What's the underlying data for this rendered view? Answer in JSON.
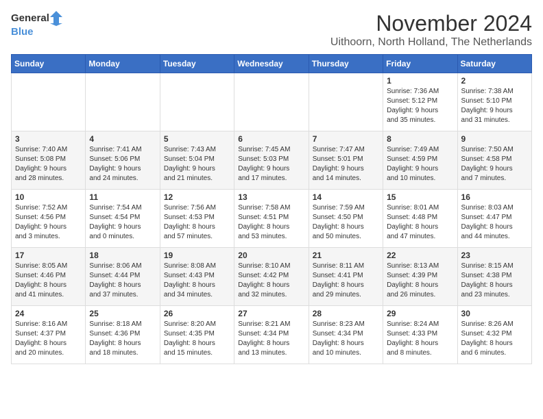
{
  "header": {
    "logo_general": "General",
    "logo_blue": "Blue",
    "month_title": "November 2024",
    "location": "Uithoorn, North Holland, The Netherlands"
  },
  "weekdays": [
    "Sunday",
    "Monday",
    "Tuesday",
    "Wednesday",
    "Thursday",
    "Friday",
    "Saturday"
  ],
  "weeks": [
    [
      {
        "day": "",
        "info": ""
      },
      {
        "day": "",
        "info": ""
      },
      {
        "day": "",
        "info": ""
      },
      {
        "day": "",
        "info": ""
      },
      {
        "day": "",
        "info": ""
      },
      {
        "day": "1",
        "info": "Sunrise: 7:36 AM\nSunset: 5:12 PM\nDaylight: 9 hours\nand 35 minutes."
      },
      {
        "day": "2",
        "info": "Sunrise: 7:38 AM\nSunset: 5:10 PM\nDaylight: 9 hours\nand 31 minutes."
      }
    ],
    [
      {
        "day": "3",
        "info": "Sunrise: 7:40 AM\nSunset: 5:08 PM\nDaylight: 9 hours\nand 28 minutes."
      },
      {
        "day": "4",
        "info": "Sunrise: 7:41 AM\nSunset: 5:06 PM\nDaylight: 9 hours\nand 24 minutes."
      },
      {
        "day": "5",
        "info": "Sunrise: 7:43 AM\nSunset: 5:04 PM\nDaylight: 9 hours\nand 21 minutes."
      },
      {
        "day": "6",
        "info": "Sunrise: 7:45 AM\nSunset: 5:03 PM\nDaylight: 9 hours\nand 17 minutes."
      },
      {
        "day": "7",
        "info": "Sunrise: 7:47 AM\nSunset: 5:01 PM\nDaylight: 9 hours\nand 14 minutes."
      },
      {
        "day": "8",
        "info": "Sunrise: 7:49 AM\nSunset: 4:59 PM\nDaylight: 9 hours\nand 10 minutes."
      },
      {
        "day": "9",
        "info": "Sunrise: 7:50 AM\nSunset: 4:58 PM\nDaylight: 9 hours\nand 7 minutes."
      }
    ],
    [
      {
        "day": "10",
        "info": "Sunrise: 7:52 AM\nSunset: 4:56 PM\nDaylight: 9 hours\nand 3 minutes."
      },
      {
        "day": "11",
        "info": "Sunrise: 7:54 AM\nSunset: 4:54 PM\nDaylight: 9 hours\nand 0 minutes."
      },
      {
        "day": "12",
        "info": "Sunrise: 7:56 AM\nSunset: 4:53 PM\nDaylight: 8 hours\nand 57 minutes."
      },
      {
        "day": "13",
        "info": "Sunrise: 7:58 AM\nSunset: 4:51 PM\nDaylight: 8 hours\nand 53 minutes."
      },
      {
        "day": "14",
        "info": "Sunrise: 7:59 AM\nSunset: 4:50 PM\nDaylight: 8 hours\nand 50 minutes."
      },
      {
        "day": "15",
        "info": "Sunrise: 8:01 AM\nSunset: 4:48 PM\nDaylight: 8 hours\nand 47 minutes."
      },
      {
        "day": "16",
        "info": "Sunrise: 8:03 AM\nSunset: 4:47 PM\nDaylight: 8 hours\nand 44 minutes."
      }
    ],
    [
      {
        "day": "17",
        "info": "Sunrise: 8:05 AM\nSunset: 4:46 PM\nDaylight: 8 hours\nand 41 minutes."
      },
      {
        "day": "18",
        "info": "Sunrise: 8:06 AM\nSunset: 4:44 PM\nDaylight: 8 hours\nand 37 minutes."
      },
      {
        "day": "19",
        "info": "Sunrise: 8:08 AM\nSunset: 4:43 PM\nDaylight: 8 hours\nand 34 minutes."
      },
      {
        "day": "20",
        "info": "Sunrise: 8:10 AM\nSunset: 4:42 PM\nDaylight: 8 hours\nand 32 minutes."
      },
      {
        "day": "21",
        "info": "Sunrise: 8:11 AM\nSunset: 4:41 PM\nDaylight: 8 hours\nand 29 minutes."
      },
      {
        "day": "22",
        "info": "Sunrise: 8:13 AM\nSunset: 4:39 PM\nDaylight: 8 hours\nand 26 minutes."
      },
      {
        "day": "23",
        "info": "Sunrise: 8:15 AM\nSunset: 4:38 PM\nDaylight: 8 hours\nand 23 minutes."
      }
    ],
    [
      {
        "day": "24",
        "info": "Sunrise: 8:16 AM\nSunset: 4:37 PM\nDaylight: 8 hours\nand 20 minutes."
      },
      {
        "day": "25",
        "info": "Sunrise: 8:18 AM\nSunset: 4:36 PM\nDaylight: 8 hours\nand 18 minutes."
      },
      {
        "day": "26",
        "info": "Sunrise: 8:20 AM\nSunset: 4:35 PM\nDaylight: 8 hours\nand 15 minutes."
      },
      {
        "day": "27",
        "info": "Sunrise: 8:21 AM\nSunset: 4:34 PM\nDaylight: 8 hours\nand 13 minutes."
      },
      {
        "day": "28",
        "info": "Sunrise: 8:23 AM\nSunset: 4:34 PM\nDaylight: 8 hours\nand 10 minutes."
      },
      {
        "day": "29",
        "info": "Sunrise: 8:24 AM\nSunset: 4:33 PM\nDaylight: 8 hours\nand 8 minutes."
      },
      {
        "day": "30",
        "info": "Sunrise: 8:26 AM\nSunset: 4:32 PM\nDaylight: 8 hours\nand 6 minutes."
      }
    ]
  ]
}
